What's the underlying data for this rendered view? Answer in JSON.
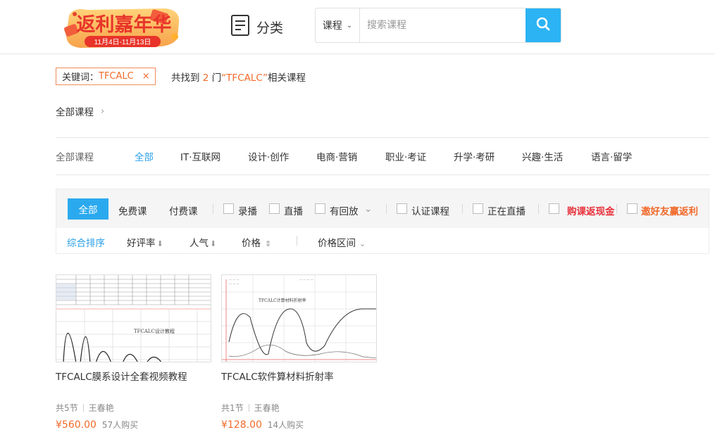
{
  "header": {
    "logo_text": "返利嘉年华",
    "logo_dates": "11月4日-11月13日",
    "category_label": "分类",
    "search_scope": "课程",
    "search_placeholder": "搜索课程"
  },
  "keyword_filter": {
    "label": "关键词：",
    "value": "TFCALC",
    "close": "×"
  },
  "result_summary": {
    "prefix": "共找到",
    "count": "2",
    "middle": "门",
    "keyword_quoted": "“TFCALC”",
    "suffix": "相关课程"
  },
  "breadcrumb": {
    "label": "全部课程",
    "chevron": "›"
  },
  "categories": {
    "label": "全部课程",
    "items": [
      "全部",
      "IT·互联网",
      "设计·创作",
      "电商·营销",
      "职业·考证",
      "升学·考研",
      "兴趣·生活",
      "语言·留学"
    ],
    "active_index": 0
  },
  "filters": {
    "tabs": [
      "全部",
      "免费课",
      "付费课"
    ],
    "checkboxes": [
      "录播",
      "直播",
      "有回放",
      "认证课程",
      "正在直播"
    ],
    "promos": [
      "购课返现金",
      "邀好友赢返利"
    ]
  },
  "sort": {
    "options": [
      "综合排序",
      "好评率",
      "人气",
      "价格",
      "价格区间"
    ],
    "active_index": 0
  },
  "courses": [
    {
      "title": "TFCALC膜系设计全套视频教程",
      "thumb_caption": "TFCALC设计教程",
      "lessons": "共5节",
      "teacher": "王春艳",
      "price": "¥560.00",
      "buyers": "57人购买"
    },
    {
      "title": "TFCALC软件算材料折射率",
      "thumb_caption": "TFCALC计算材料折射率",
      "lessons": "共1节",
      "teacher": "王春艳",
      "price": "¥128.00",
      "buyers": "14人购买"
    }
  ],
  "colors": {
    "accent_blue": "#2ba9ef",
    "accent_orange": "#f06a2b",
    "promo_red": "#e8323c"
  }
}
